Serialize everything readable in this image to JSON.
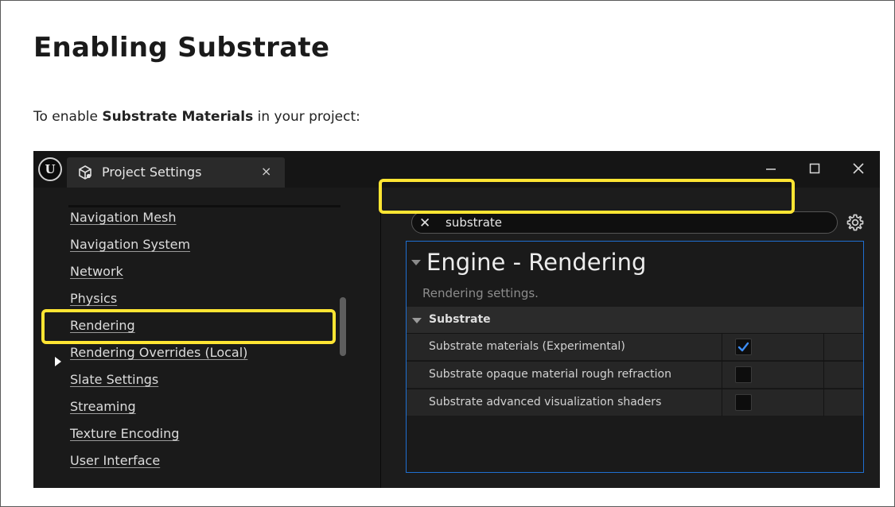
{
  "doc": {
    "title": "Enabling Substrate",
    "intro_prefix": "To enable ",
    "intro_bold": "Substrate Materials",
    "intro_suffix": " in your project:"
  },
  "window": {
    "tab_label": "Project Settings",
    "tab_close": "×"
  },
  "sidebar": {
    "items": [
      {
        "label": "Navigation Mesh"
      },
      {
        "label": "Navigation System"
      },
      {
        "label": "Network"
      },
      {
        "label": "Physics"
      },
      {
        "label": "Rendering",
        "selected": true
      },
      {
        "label": "Rendering Overrides (Local)"
      },
      {
        "label": "Slate Settings"
      },
      {
        "label": "Streaming"
      },
      {
        "label": "Texture Encoding"
      },
      {
        "label": "User Interface"
      }
    ]
  },
  "search": {
    "value": "substrate"
  },
  "details": {
    "category_title": "Engine - Rendering",
    "category_description": "Rendering settings.",
    "section_label": "Substrate",
    "properties": [
      {
        "name": "Substrate materials (Experimental)",
        "checked": true
      },
      {
        "name": "Substrate opaque material rough refraction",
        "checked": false
      },
      {
        "name": "Substrate advanced visualization shaders",
        "checked": false
      }
    ]
  },
  "colors": {
    "highlight": "#ffe533",
    "accent_blue": "#1f6fd1",
    "check_blue": "#3d8df5",
    "editor_bg": "#151515"
  },
  "icons": [
    "unreal-logo-icon",
    "project-settings-icon",
    "close-icon",
    "minimize-icon",
    "maximize-icon",
    "window-close-icon",
    "search-clear-icon",
    "gear-icon",
    "expand-arrow-icon",
    "checkmark-icon"
  ]
}
